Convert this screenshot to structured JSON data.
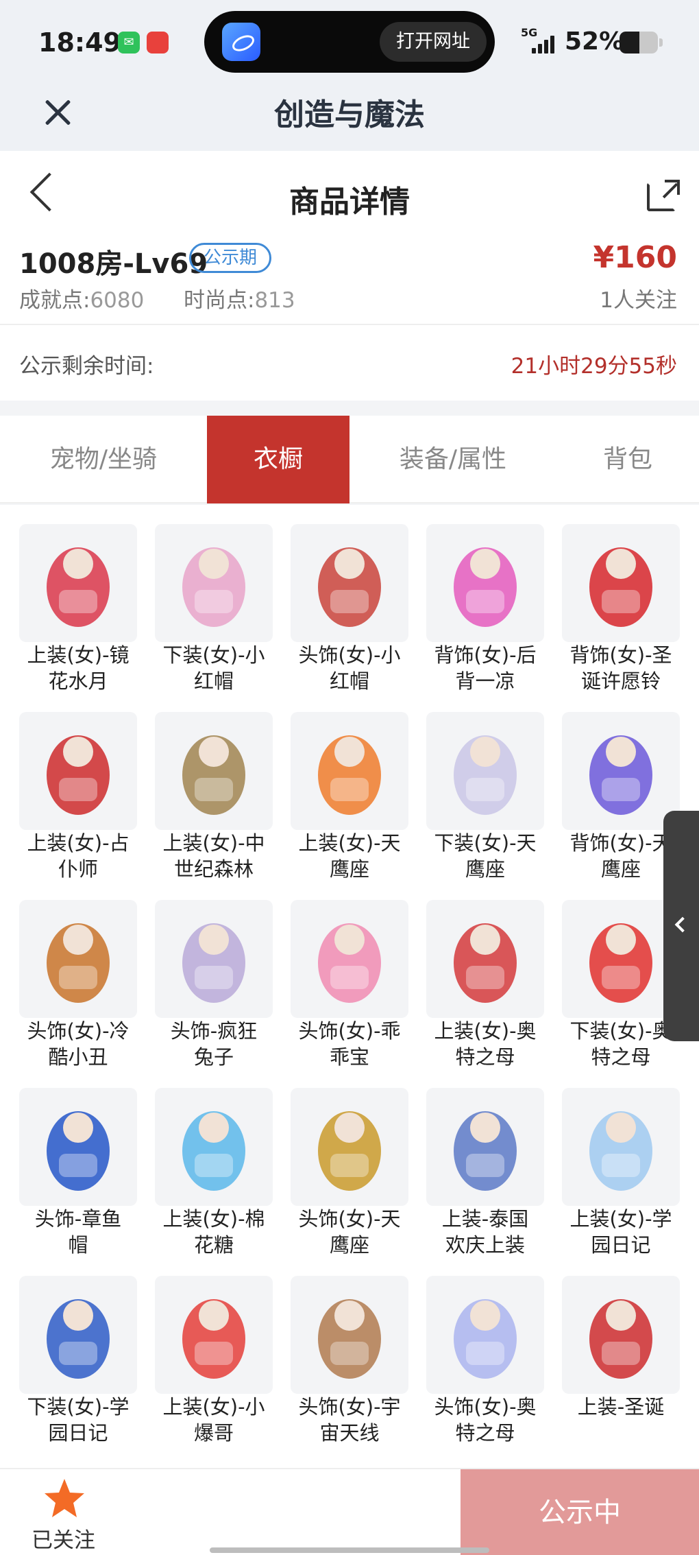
{
  "status_bar": {
    "time": "18:49",
    "network": "5G",
    "battery_pct": "52%",
    "battery_level": 0.52,
    "island_button": "打开网址",
    "wechat_icon": "wechat-icon",
    "app_icon": "red-app-icon"
  },
  "browser": {
    "title": "创造与魔法",
    "close_icon": "close-icon"
  },
  "header": {
    "title": "商品详情",
    "back_icon": "chevron-left-icon",
    "share_icon": "share-icon"
  },
  "product": {
    "name": "1008房-Lv69",
    "badge": "公示期",
    "achievement_label": "成就点:",
    "achievement_value": "6080",
    "fashion_label": "时尚点:",
    "fashion_value": "813",
    "price": "¥160",
    "followers": "1人关注"
  },
  "remaining": {
    "label": "公示剩余时间:",
    "value": "21小时29分55秒"
  },
  "tabs": [
    {
      "label": "宠物/坐骑",
      "active": false
    },
    {
      "label": "衣橱",
      "active": true
    },
    {
      "label": "装备/属性",
      "active": false
    },
    {
      "label": "背包",
      "active": false
    }
  ],
  "items": [
    {
      "line1": "上装(女)-镜",
      "line2": "花水月",
      "color": "#d9364a"
    },
    {
      "line1": "下装(女)-小",
      "line2": "红帽",
      "color": "#e7a3c9"
    },
    {
      "line1": "头饰(女)-小",
      "line2": "红帽",
      "color": "#c9433b"
    },
    {
      "line1": "背饰(女)-后",
      "line2": "背一凉",
      "color": "#e45bbd"
    },
    {
      "line1": "背饰(女)-圣",
      "line2": "诞许愿铃",
      "color": "#d6262c"
    },
    {
      "line1": "上装(女)-占",
      "line2": "仆师",
      "color": "#cc2a2c"
    },
    {
      "line1": "上装(女)-中",
      "line2": "世纪森林",
      "color": "#a08450"
    },
    {
      "line1": "上装(女)-天",
      "line2": "鹰座",
      "color": "#ef7b2c"
    },
    {
      "line1": "下装(女)-天",
      "line2": "鹰座",
      "color": "#c9c6e6"
    },
    {
      "line1": "背饰(女)-天",
      "line2": "鹰座",
      "color": "#6b58d9"
    },
    {
      "line1": "头饰(女)-冷",
      "line2": "酷小丑",
      "color": "#c8732a"
    },
    {
      "line1": "头饰-疯狂",
      "line2": "兔子",
      "color": "#b8a9d8"
    },
    {
      "line1": "头饰(女)-乖",
      "line2": "乖宝",
      "color": "#f08bb1"
    },
    {
      "line1": "上装(女)-奥",
      "line2": "特之母",
      "color": "#d33a3c"
    },
    {
      "line1": "下装(女)-奥",
      "line2": "特之母",
      "color": "#e0302e"
    },
    {
      "line1": "头饰-章鱼",
      "line2": "帽",
      "color": "#2456c8"
    },
    {
      "line1": "上装(女)-棉",
      "line2": "花糖",
      "color": "#5bb7ea"
    },
    {
      "line1": "头饰(女)-天",
      "line2": "鹰座",
      "color": "#c99a2b"
    },
    {
      "line1": "上装-泰国",
      "line2": "欢庆上装",
      "color": "#5c79c7"
    },
    {
      "line1": "上装(女)-学",
      "line2": "园日记",
      "color": "#9fc9f0"
    },
    {
      "line1": "下装(女)-学",
      "line2": "园日记",
      "color": "#2e5cc7"
    },
    {
      "line1": "上装(女)-小",
      "line2": "爆哥",
      "color": "#e43e3a"
    },
    {
      "line1": "头饰(女)-宇",
      "line2": "宙天线",
      "color": "#b07a4f"
    },
    {
      "line1": "头饰(女)-奥",
      "line2": "特之母",
      "color": "#aab4ee"
    },
    {
      "line1": "上装-圣诞",
      "line2": "",
      "color": "#cc2b2e"
    }
  ],
  "bottom_bar": {
    "fav_icon": "star-icon",
    "fav_label": "已关注",
    "cta_label": "公示中"
  },
  "colors": {
    "accent": "#c4342d",
    "badge_blue": "#3f8ad6",
    "cta_disabled": "#e29a99",
    "star": "#f36b26"
  }
}
